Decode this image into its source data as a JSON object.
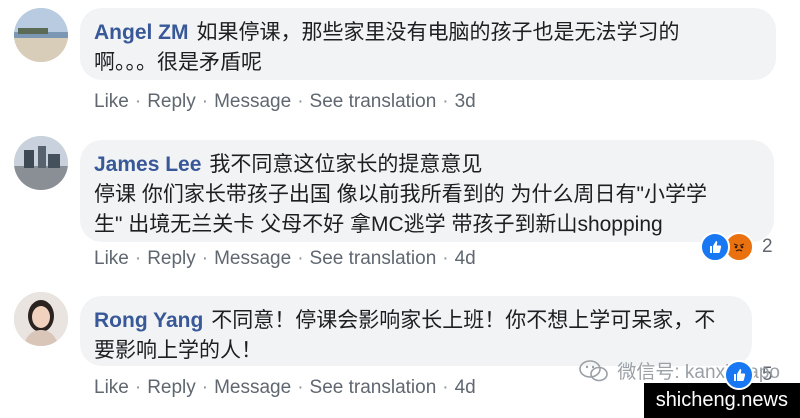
{
  "comments": [
    {
      "author": "Angel ZM",
      "text": "如果停课，那些家里没有电脑的孩子也是无法学习的\n啊。。。很是矛盾呢",
      "actions": {
        "like": "Like",
        "reply": "Reply",
        "message": "Message",
        "translate": "See translation",
        "time": "3d"
      }
    },
    {
      "author": "James Lee",
      "text": "我不同意这位家长的提意意见\n停课 你们家长带孩子出国 像以前我所看到的 为什么周日有\"小学学\n生\" 出境无兰关卡 父母不好 拿MC逃学 带孩子到新山shopping",
      "actions": {
        "like": "Like",
        "reply": "Reply",
        "message": "Message",
        "translate": "See translation",
        "time": "4d"
      },
      "reaction_count": "2"
    },
    {
      "author": "Rong Yang",
      "text": "不同意！停课会影响家长上班！你不想上学可呆家，不\n要影响上学的人！",
      "actions": {
        "like": "Like",
        "reply": "Reply",
        "message": "Message",
        "translate": "See translation",
        "time": "4d"
      },
      "reaction_count": "5"
    }
  ],
  "separator": "·",
  "watermark": "微信号: kanxinjiapo",
  "site": "shicheng.news",
  "icons": {
    "like": "thumbs-up-icon",
    "angry": "angry-face-icon",
    "wechat": "wechat-icon"
  },
  "colors": {
    "author": "#385898",
    "bubble": "#f2f3f5",
    "meta": "#606770",
    "like": "#1877f2",
    "angry": "#e9710f"
  }
}
